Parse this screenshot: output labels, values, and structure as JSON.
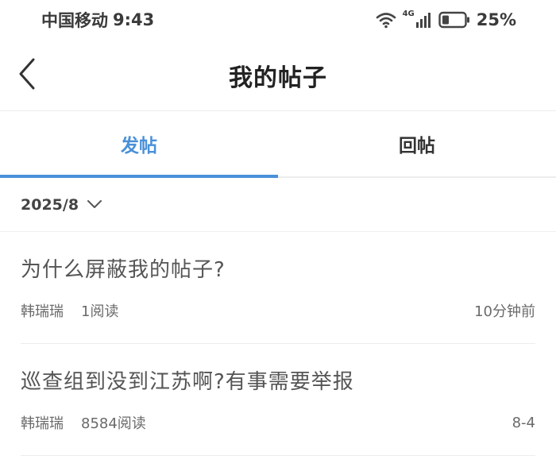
{
  "status_bar": {
    "carrier": "中国移动",
    "time": "9:43",
    "network": "4G",
    "battery": "25%"
  },
  "nav": {
    "title": "我的帖子"
  },
  "tabs": [
    {
      "label": "发帖",
      "active": true
    },
    {
      "label": "回帖",
      "active": false
    }
  ],
  "filter": {
    "label": "2025/8"
  },
  "posts": [
    {
      "title": "为什么屏蔽我的帖子?",
      "author": "韩瑞瑞",
      "reads": "1阅读",
      "time": "10分钟前"
    },
    {
      "title": "巡查组到没到江苏啊?有事需要举报",
      "author": "韩瑞瑞",
      "reads": "8584阅读",
      "time": "8-4"
    }
  ],
  "colors": {
    "accent": "#4a90d9"
  }
}
